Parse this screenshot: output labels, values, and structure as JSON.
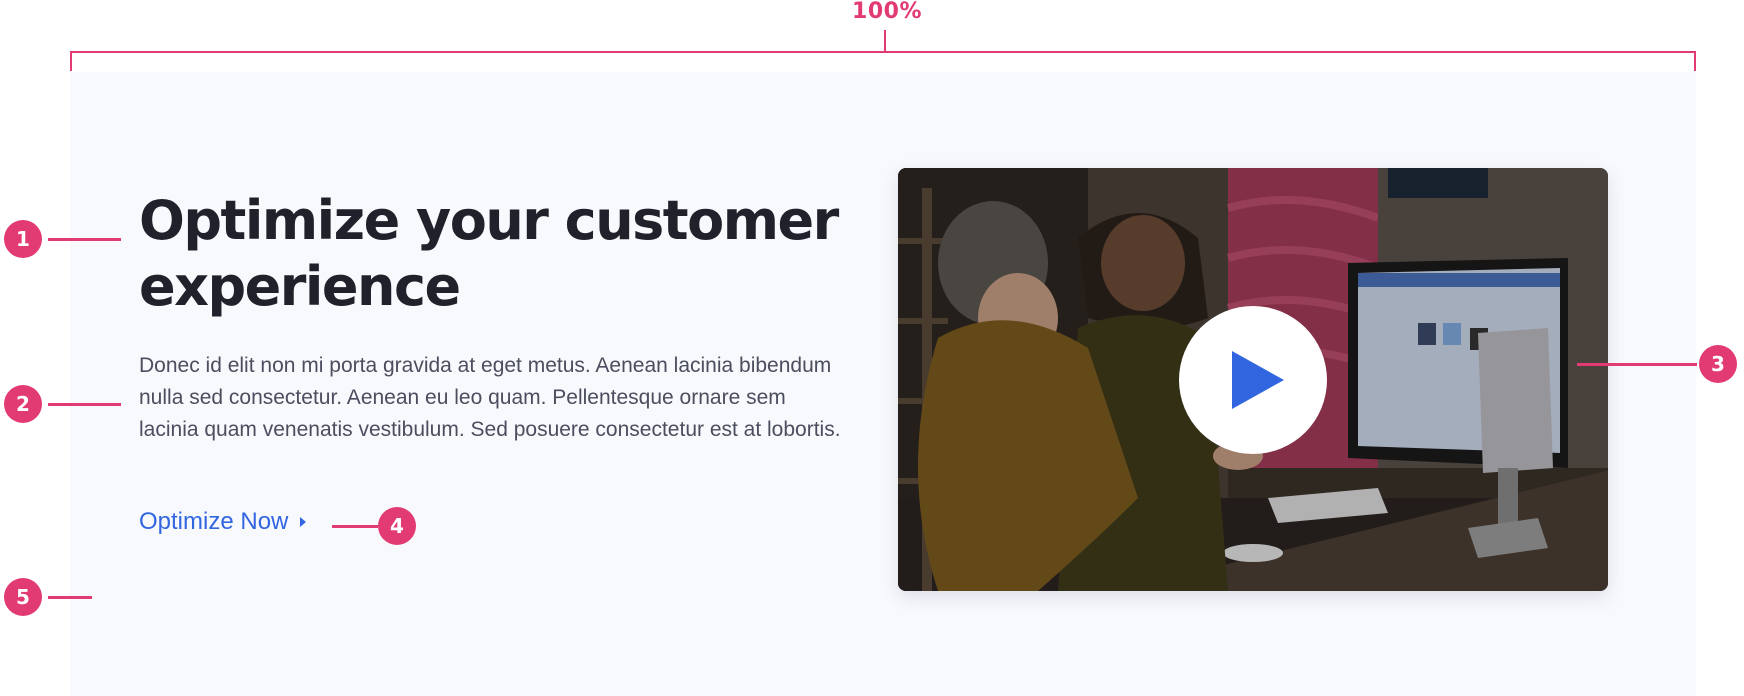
{
  "spec": {
    "width_label": "100%",
    "markers": [
      "1",
      "2",
      "3",
      "4",
      "5"
    ]
  },
  "hero": {
    "heading": "Optimize your customer experience",
    "body": "Donec id elit non mi porta gravida at eget metus. Aenean lacinia bibendum nulla sed consectetur. Aenean eu leo quam. Pellentesque ornare sem lacinia quam venenatis vestibulum. Sed posuere consectetur est at lobortis.",
    "cta_label": "Optimize Now",
    "cta_icon": "caret-right-icon"
  },
  "video": {
    "play_icon": "play-icon"
  },
  "colors": {
    "accent": "#e23a72",
    "link": "#3266e0",
    "heading": "#20212b",
    "body_text": "#4b4e5e",
    "panel_bg": "#f8f9fd"
  }
}
